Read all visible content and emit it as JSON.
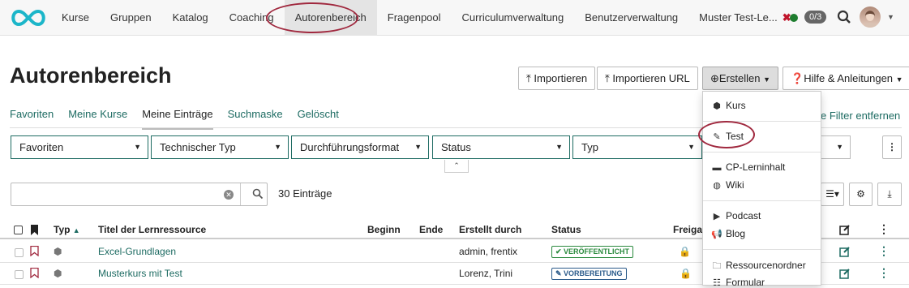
{
  "nav": {
    "items": [
      "Kurse",
      "Gruppen",
      "Katalog",
      "Coaching",
      "Autorenbereich",
      "Fragenpool",
      "Curriculumverwaltung",
      "Benutzerverwaltung",
      "Muster Test-Le..."
    ],
    "active": "Autorenbereich",
    "close_label": "✖",
    "counter": "0/3"
  },
  "page": {
    "title": "Autorenbereich",
    "buttons": {
      "import": "Importieren",
      "import_url": "Importieren URL",
      "create": "Erstellen",
      "help": "Hilfe & Anleitungen"
    }
  },
  "tabs": [
    "Favoriten",
    "Meine Kurse",
    "Meine Einträge",
    "Suchmaske",
    "Gelöscht"
  ],
  "active_tab": "Meine Einträge",
  "filter_remove": "e Filter entfernen",
  "filters": [
    "Favoriten",
    "Technischer Typ",
    "Durchführungsformat",
    "Status",
    "Typ"
  ],
  "search": {
    "value": "",
    "placeholder": ""
  },
  "entry_count": "30 Einträge",
  "table": {
    "headers": [
      "Typ",
      "Titel der Lernressource",
      "Beginn",
      "Ende",
      "Erstellt durch",
      "Status",
      "Freigab"
    ],
    "rows": [
      {
        "title": "Excel-Grundlagen",
        "creator": "admin, frentix",
        "status": "✔ VERÖFFENTLICHT"
      },
      {
        "title": "Musterkurs mit Test",
        "creator": "Lorenz, Trini",
        "status": "✎ VORBEREITUNG"
      }
    ]
  },
  "create_menu": [
    "Kurs",
    "Test",
    "CP-Lerninhalt",
    "Wiki",
    "Podcast",
    "Blog",
    "Ressourcenordner",
    "Formular"
  ],
  "colors": {
    "accent": "#1d6b62",
    "highlight_circle": "#a0283e",
    "published": "#2b8a3e",
    "preparation": "#2a5a8a"
  }
}
